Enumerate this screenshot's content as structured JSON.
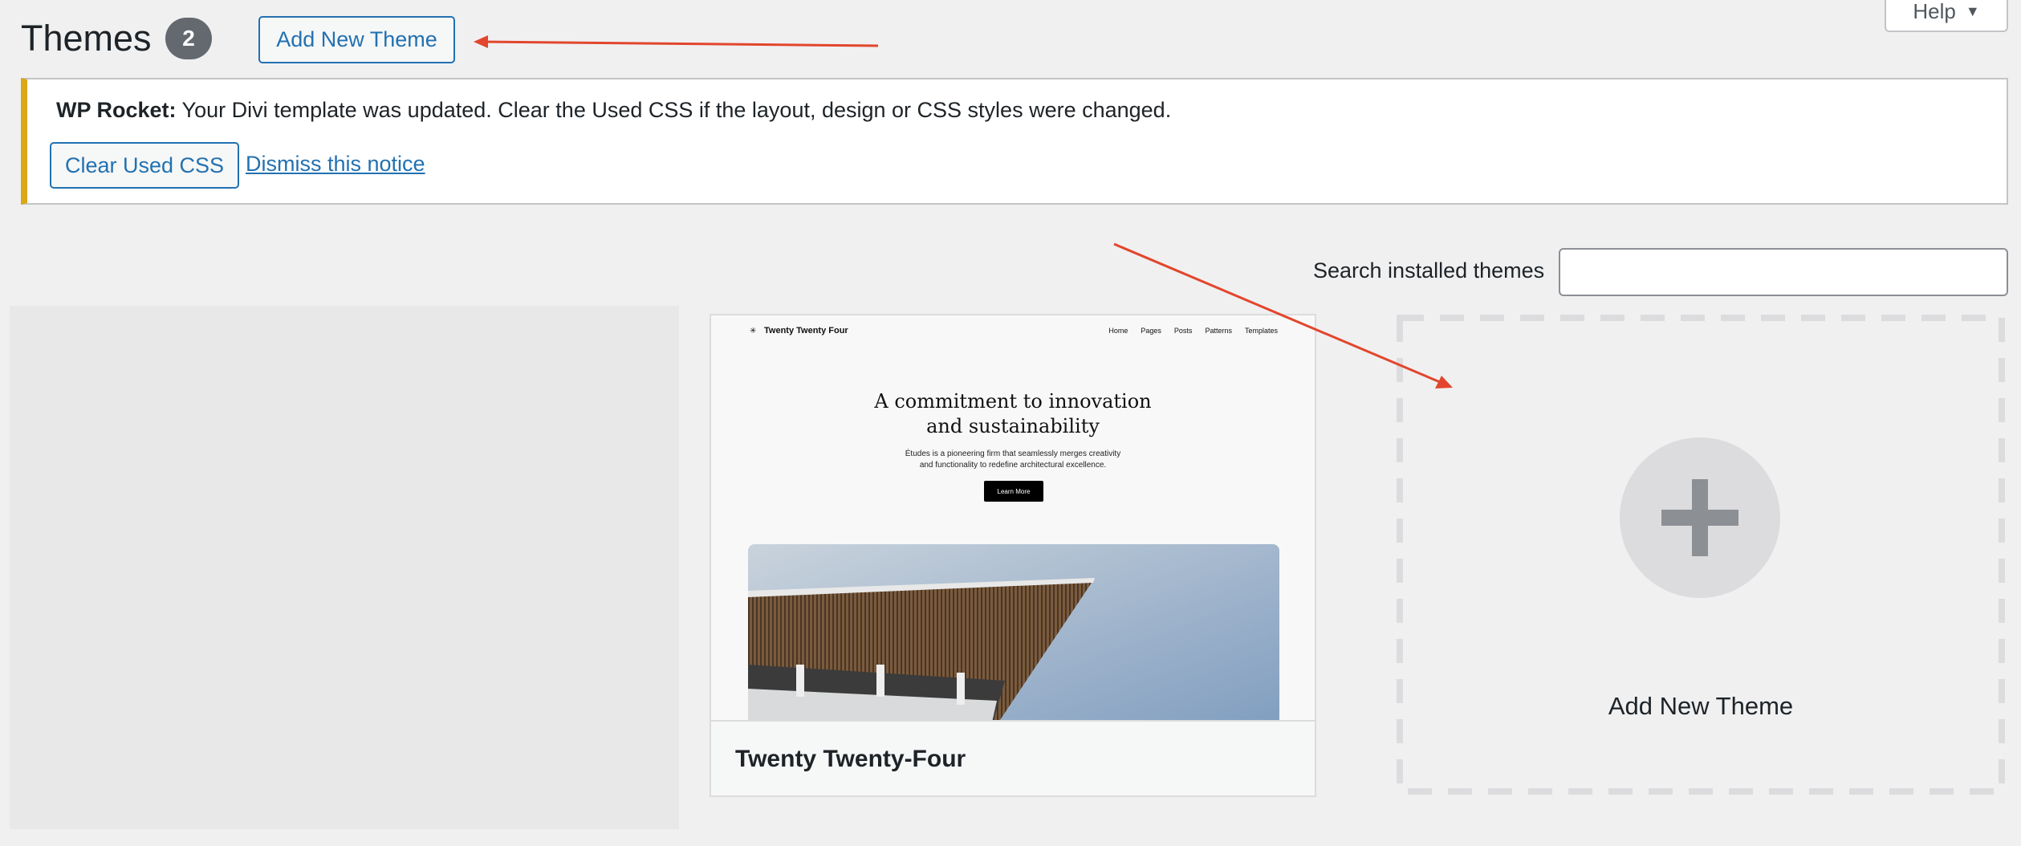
{
  "header": {
    "title": "Themes",
    "count": "2",
    "add_new_label": "Add New Theme",
    "help_label": "Help"
  },
  "notice": {
    "prefix": "WP Rocket:",
    "message": "Your Divi template was updated. Clear the Used CSS if the layout, design or CSS styles were changed.",
    "clear_button": "Clear Used CSS",
    "dismiss_link": "Dismiss this notice",
    "accent_color": "#dba617"
  },
  "search": {
    "label": "Search installed themes",
    "value": ""
  },
  "themes": [
    {
      "name": "Twenty Twenty-Four",
      "preview": {
        "site_title": "Twenty Twenty Four",
        "nav": [
          "Home",
          "Pages",
          "Posts",
          "Patterns",
          "Templates"
        ],
        "headline_line1": "A commitment to innovation",
        "headline_line2": "and sustainability",
        "desc_line1": "Études is a pioneering firm that seamlessly merges creativity",
        "desc_line2": "and functionality to redefine architectural excellence.",
        "button": "Learn More"
      }
    }
  ],
  "add_new_card": {
    "label": "Add New Theme",
    "icon": "plus-icon"
  },
  "annotation_color": "#e2462c"
}
